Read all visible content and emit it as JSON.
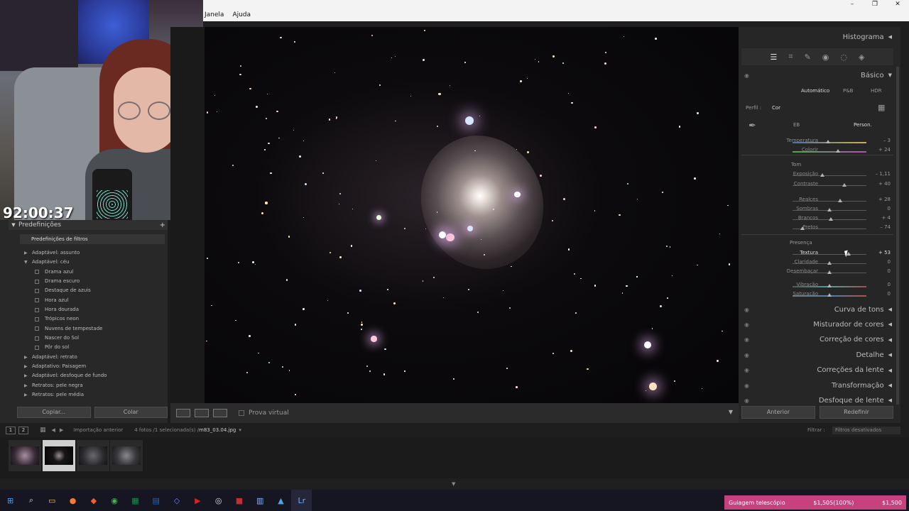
{
  "menu": {
    "items": [
      "Janela",
      "Ajuda"
    ]
  },
  "window_controls": {
    "minimize": "–",
    "maximize": "❐",
    "close": "✕"
  },
  "webcam": {
    "timer": "92:00:37"
  },
  "left_panel": {
    "title": "Predefinições",
    "add": "+",
    "folder": "Predefinições de filtros",
    "items": [
      {
        "label": "Adaptável: assunto",
        "type": "folder",
        "open": false
      },
      {
        "label": "Adaptável: céu",
        "type": "folder",
        "open": true
      },
      {
        "label": "Drama azul",
        "type": "preset"
      },
      {
        "label": "Drama escuro",
        "type": "preset"
      },
      {
        "label": "Destaque de azuis",
        "type": "preset"
      },
      {
        "label": "Hora azul",
        "type": "preset"
      },
      {
        "label": "Hora dourada",
        "type": "preset"
      },
      {
        "label": "Trópicos neon",
        "type": "preset"
      },
      {
        "label": "Nuvens de tempestade",
        "type": "preset"
      },
      {
        "label": "Nascer do Sol",
        "type": "preset"
      },
      {
        "label": "Pôr do sol",
        "type": "preset"
      },
      {
        "label": "Adaptável: retrato",
        "type": "folder",
        "open": false
      },
      {
        "label": "Adaptativo: Paisagem",
        "type": "folder",
        "open": false
      },
      {
        "label": "Adaptável: desfoque de fundo",
        "type": "folder",
        "open": false
      },
      {
        "label": "Retratos: pele negra",
        "type": "folder",
        "open": false
      },
      {
        "label": "Retratos: pele média",
        "type": "folder",
        "open": false
      }
    ],
    "copy_button": "Copiar...",
    "paste_button": "Colar"
  },
  "toolbar": {
    "soft_proof": "Prova virtual"
  },
  "right_panel": {
    "histogram": "Histograma",
    "basic": "Básico",
    "treatment": {
      "auto": "Automático",
      "bw": "P&B",
      "hdr": "HDR"
    },
    "profile_label": "Perfil :",
    "profile_value": "Cor",
    "wb_label": "EB",
    "wb_value": "Person.",
    "tone_label": "Tom",
    "presence_label": "Presença",
    "sliders": [
      {
        "label": "Temperatura",
        "value": "– 3",
        "pos": 0.48
      },
      {
        "label": "Colorir",
        "value": "+ 24",
        "pos": 0.62
      },
      {
        "label": "Exposição",
        "value": "– 1,11",
        "pos": 0.4
      },
      {
        "label": "Contraste",
        "value": "+ 40",
        "pos": 0.7
      },
      {
        "label": "Realces",
        "value": "+ 28",
        "pos": 0.64
      },
      {
        "label": "Sombras",
        "value": "0",
        "pos": 0.5
      },
      {
        "label": "Brancos",
        "value": "+ 4",
        "pos": 0.52
      },
      {
        "label": "Pretos",
        "value": "– 74",
        "pos": 0.13
      },
      {
        "label": "Textura",
        "value": "+ 53",
        "pos": 0.76
      },
      {
        "label": "Claridade",
        "value": "0",
        "pos": 0.5
      },
      {
        "label": "Desembaçar",
        "value": "0",
        "pos": 0.5
      },
      {
        "label": "Vibração",
        "value": "0",
        "pos": 0.5
      },
      {
        "label": "Saturação",
        "value": "0",
        "pos": 0.5
      }
    ],
    "sections": [
      "Curva de tons",
      "Misturador de cores",
      "Correção de cores",
      "Detalhe",
      "Correções da lente",
      "Transformação",
      "Desfoque de lente"
    ],
    "prev_button": "Anterior",
    "reset_button": "Redefinir"
  },
  "filmstrip": {
    "view1": "1",
    "view2": "2",
    "source": "Importação anterior",
    "info_count": "4 fotos /1 selecionada(s) /",
    "info_file": "m83_03.04.jpg",
    "filter_label": "Filtrar :",
    "filter_value": "Filtros desativados"
  },
  "notification": {
    "label": "Guiagem telescópio",
    "value": "$1,505(100%)",
    "total": "$1,500"
  },
  "colors": {
    "accent": "#c7417f",
    "panel": "#262626"
  }
}
